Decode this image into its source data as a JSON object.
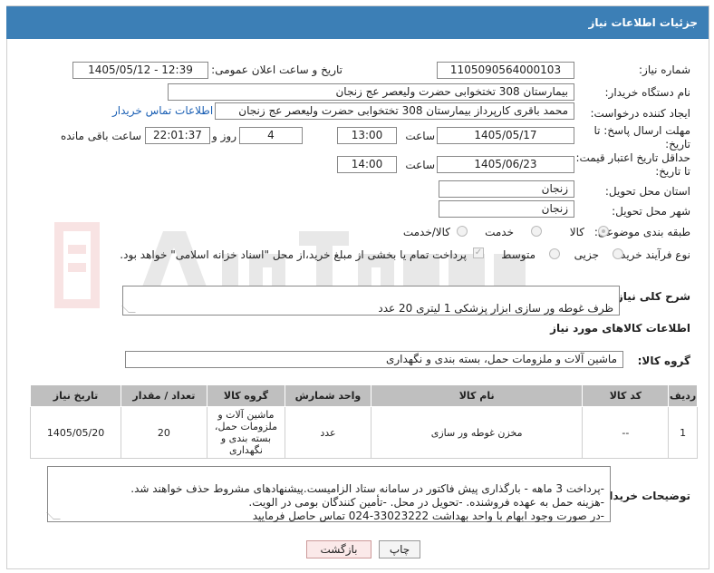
{
  "window": {
    "title": "جزئیات اطلاعات نیاز"
  },
  "fields": {
    "need_number_label": "شماره نیاز:",
    "need_number": "1105090564000103",
    "announce_label": "تاریخ و ساعت اعلان عمومی:",
    "announce_value": "1405/05/12 - 12:39",
    "buyer_org_label": "نام دستگاه خریدار:",
    "buyer_org": "بیمارستان 308 تختخوابی حضرت ولیعصر عج  زنجان",
    "creator_label": "ایجاد کننده درخواست:",
    "creator": "محمد باقری کارپرداز بیمارستان 308 تختخوابی حضرت ولیعصر عج  زنجان",
    "buyer_contact_link": "اطلاعات تماس خریدار",
    "deadline_label": "مهلت ارسال پاسخ: تا تاریخ:",
    "deadline_date": "1405/05/17",
    "time_label": "ساعت",
    "deadline_time": "13:00",
    "days_value": "4",
    "days_and_label": "روز و",
    "remaining_time": "22:01:37",
    "remaining_label": "ساعت باقی مانده",
    "min_validity_label": "حداقل تاریخ اعتبار قیمت: تا تاریخ:",
    "validity_date": "1405/06/23",
    "validity_time_label": "ساعت",
    "validity_time": "14:00",
    "province_label": "استان محل تحویل:",
    "province": "زنجان",
    "city_label": "شهر محل تحویل:",
    "city": "زنجان",
    "category_label": "طبقه بندی موضوعی:",
    "category_options": [
      "کالا",
      "خدمت",
      "کالا/خدمت"
    ],
    "process_label": "نوع فرآیند خرید :",
    "process_options": [
      "جزیی",
      "متوسط"
    ],
    "payment_note": "پرداخت تمام یا بخشی از مبلغ خرید،از محل \"اسناد خزانه اسلامی\" خواهد بود."
  },
  "description": {
    "label": "شرح کلی نیاز:",
    "value": "ظرف غوطه ور سازی ابزار پزشکی 1 لیتری 20 عدد"
  },
  "goods_info": {
    "title": "اطلاعات کالاهای مورد نیاز",
    "group_label": "گروه کالا:",
    "group_value": "ماشین آلات و ملزومات حمل، بسته بندی و نگهداری"
  },
  "table": {
    "headers": [
      "ردیف",
      "کد کالا",
      "نام کالا",
      "واحد شمارش",
      "گروه کالا",
      "تعداد / مقدار",
      "تاریخ نیاز"
    ],
    "rows": [
      [
        "1",
        "--",
        "مخزن غوطه ور سازی",
        "عدد",
        "ماشین آلات و ملزومات حمل، بسته بندی و نگهداری",
        "20",
        "1405/05/20"
      ]
    ]
  },
  "buyer_notes": {
    "label": "توضیحات خریدار:",
    "value": "-پرداخت  3 ماهه - بارگذاری پیش فاکتور در سامانه ستاد الزامیست.پیشنهادهای مشروط حذف خواهند شد.\n-هزینه حمل به عهده فروشنده. -تحویل در محل. -تأمین کنندگان بومی در الویت.\n-در صورت وجود ابهام با واحد بهداشت 33023222-024 تماس حاصل فرمایید"
  },
  "buttons": {
    "print": "چاپ",
    "back": "بازگشت"
  },
  "colors": {
    "titlebar": "#3c7fb6",
    "link": "#1a5fb4"
  }
}
